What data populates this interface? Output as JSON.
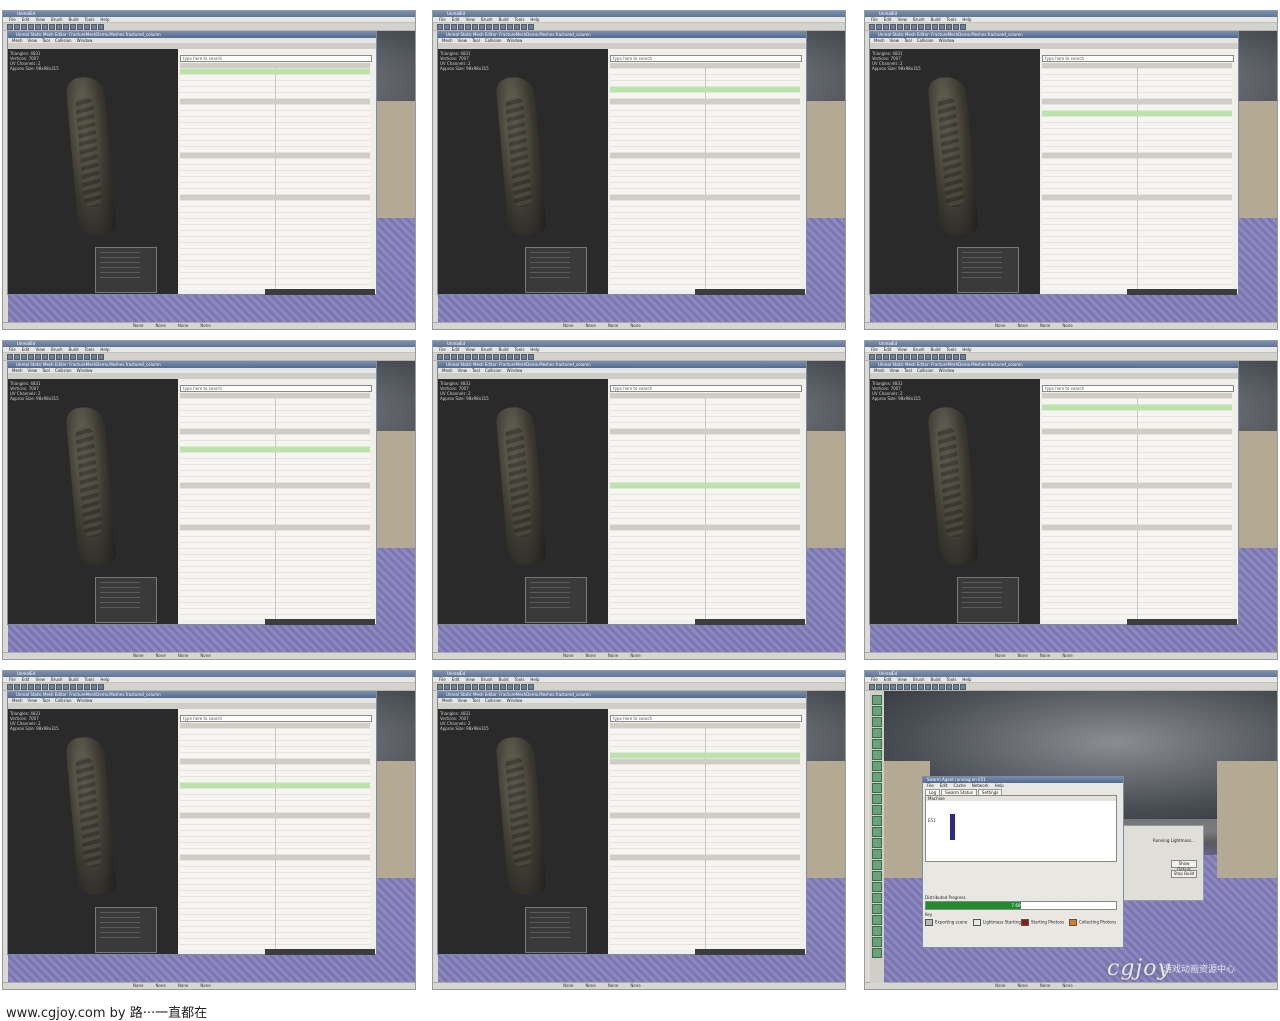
{
  "app": {
    "title": "UnrealEd",
    "menus": [
      "File",
      "Edit",
      "View",
      "Brush",
      "Build",
      "Tools",
      "Help"
    ]
  },
  "editor": {
    "title": "Unreal Static Mesh Editor: FractureMeshDemo.Meshes.fractured_column",
    "menus": [
      "Mesh",
      "View",
      "Tool",
      "Collision",
      "Window"
    ],
    "stats": [
      "Triangles: 4831",
      "Vertices: 7007",
      "UV Channels: 2",
      "Approx Size: 98x98x315"
    ],
    "search_placeholder": "type here to search",
    "properties_path": "Properties: FractureMeshDemo.Meshes.fractured_column",
    "property_rows": [
      "Body Setup",
      "Chance Of Physics Chunk",
      "Chunk Ang Vel",
      "Chunk Lin Hor Scale",
      "Chunk Lin Vel",
      "Composite Chunks Explode On Impact?",
      "Core Mesh Scale",
      "Dynamic Outside Material",
      "Explosion Chance Of Physics Chunk",
      "Explosion Physics Chunk Scale Max",
      "Explosion Physics Chunk Scale Min",
      "Explosion Vel Scale",
      "Fix Isolated Chunks?",
      "Force Double Sided Shadow Volumes?",
      "Fragment Destroy Effect Scale",
      "Fragment Destroy Effects",
      "Fragment Health Scale",
      "Fragment Max Health",
      "Fragment Min Health",
      "Light Map Coordinate Index",
      "Light Map Resolution",
      "LODDistance Ratio",
      "LODInfo",
      "Lose Chunk Outside Material"
    ]
  },
  "status": {
    "items": [
      "None",
      "None",
      "None",
      "None"
    ]
  },
  "swarm": {
    "title": "Swarm Agent running on E51",
    "menus": [
      "File",
      "Edit",
      "Cache",
      "Network",
      "Help"
    ],
    "tabs": [
      "Log",
      "Swarm Status",
      "Settings"
    ],
    "column_header": "Machine",
    "machine": "E51",
    "progress_label": "Distributed Progress",
    "progress_text": "7.60%",
    "progress_percent": 50,
    "key_label": "Key",
    "keys": [
      {
        "label": "Exporting scene",
        "color": "#b8b8b8"
      },
      {
        "label": "Lightmass Starting",
        "color": "#e8e8e8"
      },
      {
        "label": "Starting Photons",
        "color": "#8b1a1a"
      },
      {
        "label": "Collecting Photons",
        "color": "#e07b1a"
      }
    ]
  },
  "lightmass": {
    "status": "Running Lightmass...",
    "show_details": "Show Details",
    "stop_build": "Stop Build"
  },
  "watermark": {
    "logo": "cgjoy",
    "chinese": "游戏动画资源中心"
  },
  "footer": {
    "text": "www.cgjoy.com by 路···一直都在"
  },
  "colors": {
    "highlight_row": "#b9e6a8",
    "titlebar": "#5f7598",
    "floor": "#8a85b8",
    "progress": "#1f8c2e"
  }
}
